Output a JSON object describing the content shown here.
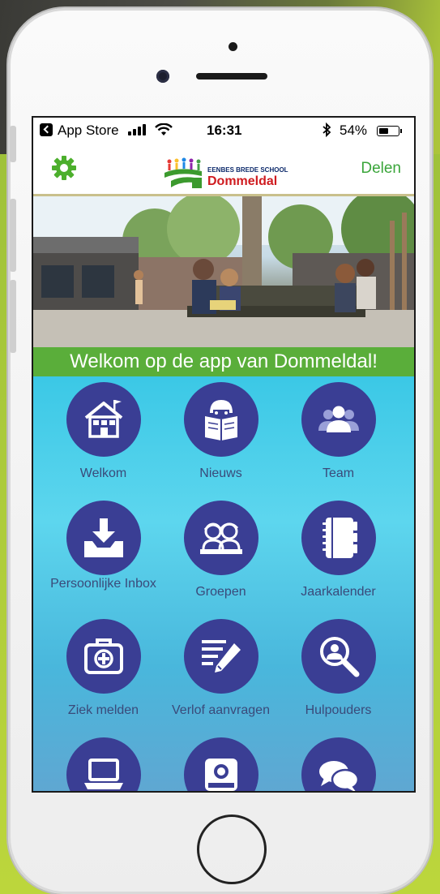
{
  "status_bar": {
    "carrier": "App Store",
    "time": "16:31",
    "battery": "54%",
    "battery_level": 0.54
  },
  "nav": {
    "logo_line1": "EENBES BREDE SCHOOL",
    "logo_line2": "Dommeldal",
    "share_label": "Delen"
  },
  "banner": {
    "welcome_text": "Welkom op de app van Dommeldal!"
  },
  "tiles": [
    {
      "label": "Welkom",
      "icon": "school-house-icon"
    },
    {
      "label": "Nieuws",
      "icon": "reading-newspaper-icon"
    },
    {
      "label": "Team",
      "icon": "team-people-icon"
    },
    {
      "label": "Persoonlijke Inbox",
      "icon": "inbox-download-icon"
    },
    {
      "label": "Groepen",
      "icon": "children-group-icon"
    },
    {
      "label": "Jaarkalender",
      "icon": "calendar-notebook-icon"
    },
    {
      "label": "Ziek melden",
      "icon": "first-aid-kit-icon"
    },
    {
      "label": "Verlof aanvragen",
      "icon": "edit-document-icon"
    },
    {
      "label": "Hulpouders",
      "icon": "search-person-icon"
    },
    {
      "label": "",
      "icon": "laptop-icon"
    },
    {
      "label": "",
      "icon": "camera-icon"
    },
    {
      "label": "",
      "icon": "chat-bubbles-icon"
    }
  ],
  "colors": {
    "accent_green": "#3aa53a",
    "banner_green": "#5aae3a",
    "tile_circle": "#3a3e94",
    "tile_label": "#3a4a7a"
  }
}
